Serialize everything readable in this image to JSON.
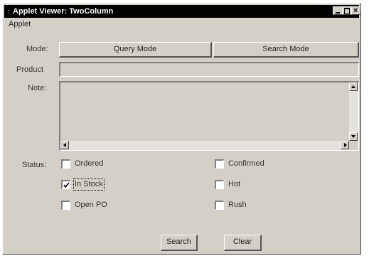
{
  "window": {
    "title": "Applet Viewer: TwoColumn",
    "title_icon": "java-cup-icon"
  },
  "menu": {
    "applet_label": "Applet"
  },
  "form": {
    "mode_label": "Mode:",
    "query_mode_label": "Query Mode",
    "search_mode_label": "Search Mode",
    "product_label": "Product",
    "product_value": "",
    "note_label": "Note:",
    "note_value": "",
    "status_label": "Status:",
    "statuses": [
      {
        "label": "Ordered",
        "checked": false
      },
      {
        "label": "In Stock",
        "checked": true,
        "focused": true
      },
      {
        "label": "Open PO",
        "checked": false
      },
      {
        "label": "Confirmed",
        "checked": false
      },
      {
        "label": "Hot",
        "checked": false
      },
      {
        "label": "Rush",
        "checked": false
      }
    ],
    "search_label": "Search",
    "clear_label": "Clear"
  }
}
